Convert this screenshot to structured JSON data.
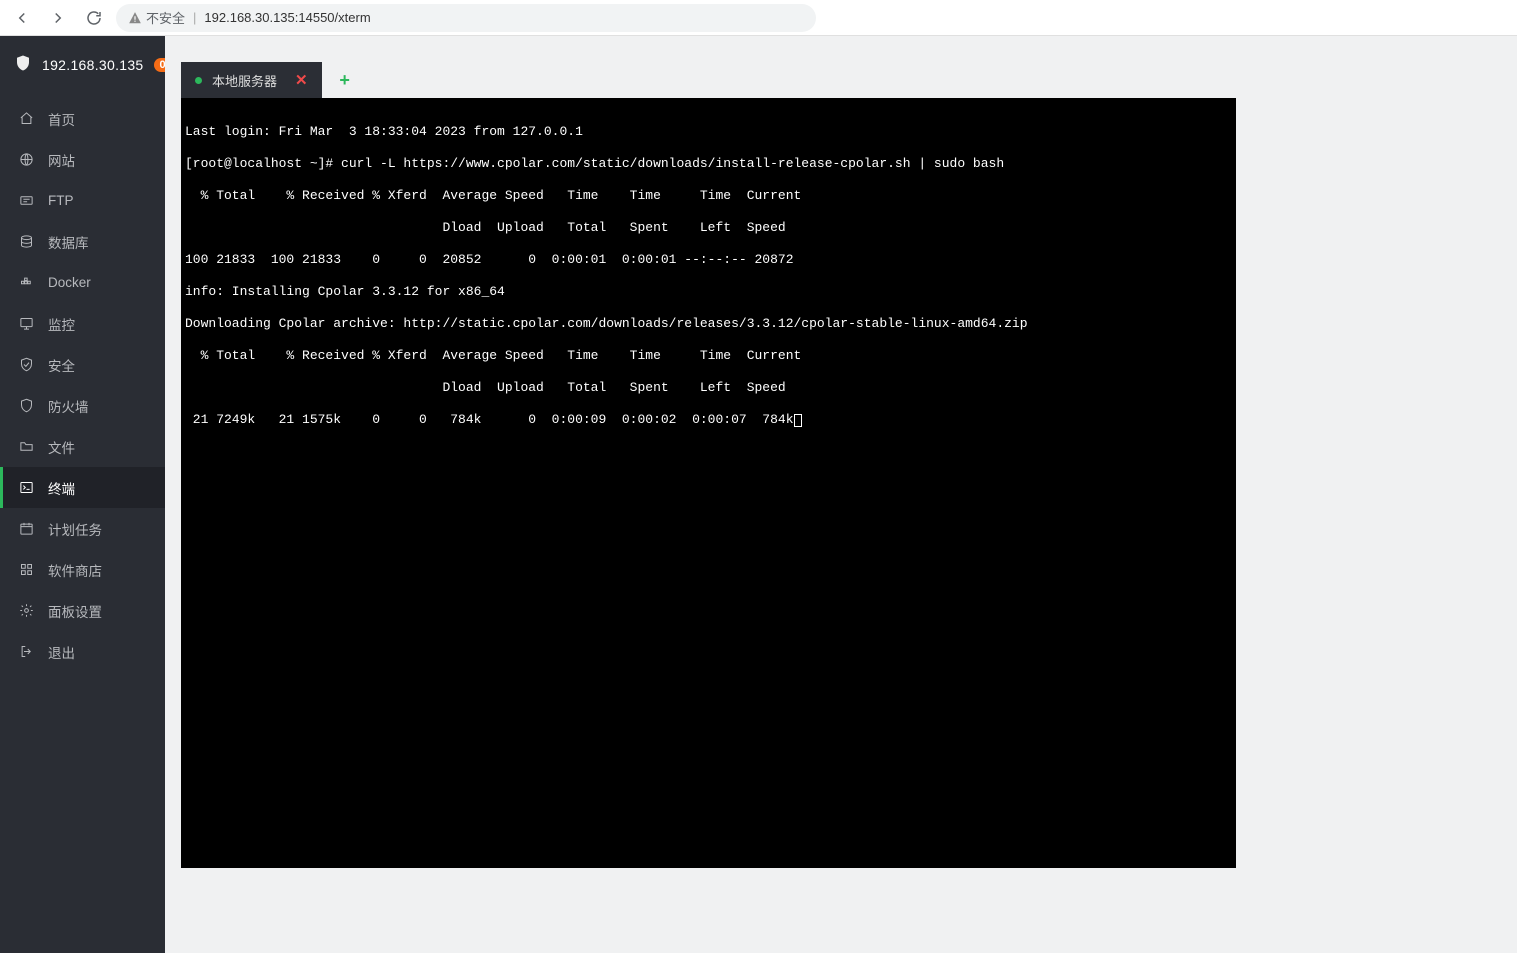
{
  "browser": {
    "security_label": "不安全",
    "url": "192.168.30.135:14550/xterm"
  },
  "sidebar": {
    "ip": "192.168.30.135",
    "badge": "0",
    "items": [
      {
        "id": "home",
        "label": "首页"
      },
      {
        "id": "site",
        "label": "网站"
      },
      {
        "id": "ftp",
        "label": "FTP"
      },
      {
        "id": "db",
        "label": "数据库"
      },
      {
        "id": "docker",
        "label": "Docker"
      },
      {
        "id": "monitor",
        "label": "监控"
      },
      {
        "id": "security",
        "label": "安全"
      },
      {
        "id": "firewall",
        "label": "防火墙"
      },
      {
        "id": "files",
        "label": "文件"
      },
      {
        "id": "terminal",
        "label": "终端"
      },
      {
        "id": "cron",
        "label": "计划任务"
      },
      {
        "id": "store",
        "label": "软件商店"
      },
      {
        "id": "settings",
        "label": "面板设置"
      },
      {
        "id": "logout",
        "label": "退出"
      }
    ],
    "active": "terminal"
  },
  "tabs": {
    "items": [
      {
        "label": "本地服务器",
        "status": "green"
      }
    ]
  },
  "terminal": {
    "lines": [
      "Last login: Fri Mar  3 18:33:04 2023 from 127.0.0.1",
      "[root@localhost ~]# curl -L https://www.cpolar.com/static/downloads/install-release-cpolar.sh | sudo bash",
      "  % Total    % Received % Xferd  Average Speed   Time    Time     Time  Current",
      "                                 Dload  Upload   Total   Spent    Left  Speed",
      "100 21833  100 21833    0     0  20852      0  0:00:01  0:00:01 --:--:-- 20872",
      "info: Installing Cpolar 3.3.12 for x86_64",
      "Downloading Cpolar archive: http://static.cpolar.com/downloads/releases/3.3.12/cpolar-stable-linux-amd64.zip",
      "  % Total    % Received % Xferd  Average Speed   Time    Time     Time  Current",
      "                                 Dload  Upload   Total   Spent    Left  Speed",
      " 21 7249k   21 1575k    0     0   784k      0  0:00:09  0:00:02  0:00:07  784k"
    ]
  }
}
